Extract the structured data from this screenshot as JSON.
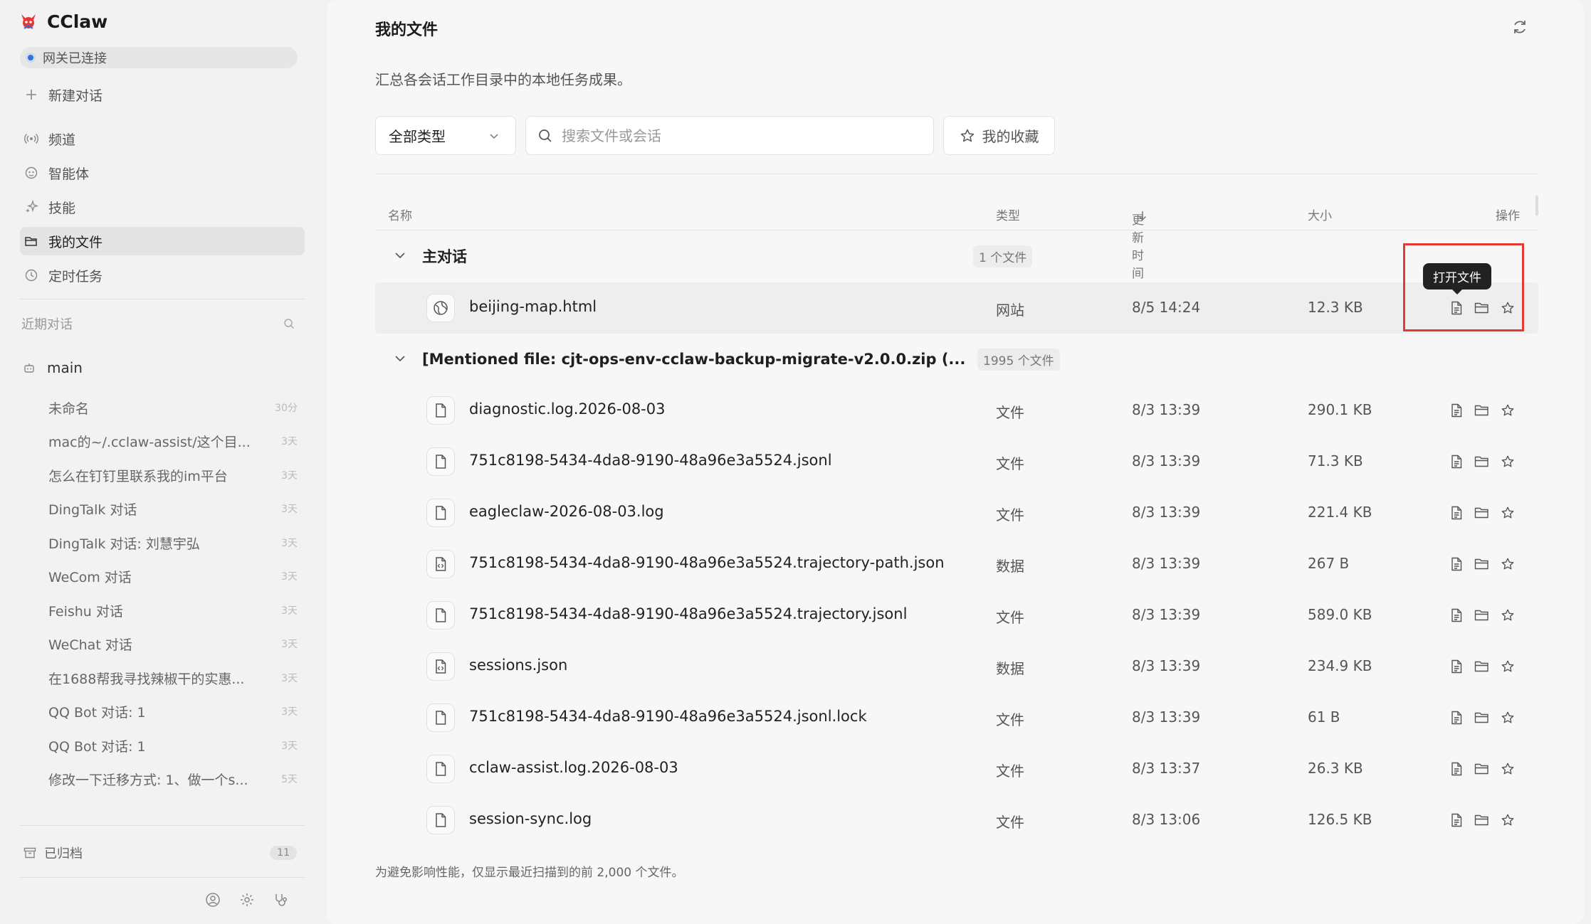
{
  "app": {
    "name": "CClaw",
    "brand_color": "#e53935"
  },
  "gateway": {
    "status": "网关已连接",
    "dot_color": "#2b74d8"
  },
  "nav": {
    "new_chat": "新建对话",
    "channels": "频道",
    "agents": "智能体",
    "skills": "技能",
    "my_files": "我的文件",
    "scheduled": "定时任务"
  },
  "recent": {
    "header": "近期对话",
    "group": "main",
    "items": [
      {
        "title": "未命名",
        "time": "30分"
      },
      {
        "title": "mac的~/.cclaw-assist/这个目...",
        "time": "3天"
      },
      {
        "title": "怎么在钉钉里联系我的im平台",
        "time": "3天"
      },
      {
        "title": "DingTalk 对话",
        "time": "3天"
      },
      {
        "title": "DingTalk 对话: 刘慧宇弘",
        "time": "3天"
      },
      {
        "title": "WeCom 对话",
        "time": "3天"
      },
      {
        "title": "Feishu 对话",
        "time": "3天"
      },
      {
        "title": "WeChat 对话",
        "time": "3天"
      },
      {
        "title": "在1688帮我寻找辣椒干的实惠...",
        "time": "3天"
      },
      {
        "title": "QQ Bot 对话: 1",
        "time": "3天"
      },
      {
        "title": "QQ Bot 对话: 1",
        "time": "3天"
      },
      {
        "title": "修改一下迁移方式: 1、做一个s...",
        "time": "5天"
      }
    ]
  },
  "archived": {
    "label": "已归档",
    "count": "11"
  },
  "page": {
    "title": "我的文件",
    "subtitle": "汇总各会话工作目录中的本地任务成果。",
    "type_filter": "全部类型",
    "search_placeholder": "搜索文件或会话",
    "favorites": "我的收藏",
    "footnote": "为避免影响性能，仅显示最近扫描到的前 2,000 个文件。"
  },
  "table": {
    "headers": {
      "name": "名称",
      "type": "类型",
      "updated": "更新时间",
      "size": "大小",
      "actions": "操作"
    },
    "tooltip": "打开文件",
    "groups": [
      {
        "title": "主对话",
        "count": "1 个文件"
      },
      {
        "title": "[Mentioned file: cjt-ops-env-cclaw-backup-migrate-v2.0.0.zip (...",
        "count": "1995 个文件"
      }
    ],
    "rows": [
      {
        "name": "beijing-map.html",
        "type": "网站",
        "time": "8/5 14:24",
        "size": "12.3 KB",
        "icon": "globe-icon"
      },
      {
        "name": "diagnostic.log.2026-08-03",
        "type": "文件",
        "time": "8/3 13:39",
        "size": "290.1 KB",
        "icon": "file-icon"
      },
      {
        "name": "751c8198-5434-4da8-9190-48a96e3a5524.jsonl",
        "type": "文件",
        "time": "8/3 13:39",
        "size": "71.3 KB",
        "icon": "file-icon"
      },
      {
        "name": "eagleclaw-2026-08-03.log",
        "type": "文件",
        "time": "8/3 13:39",
        "size": "221.4 KB",
        "icon": "file-icon"
      },
      {
        "name": "751c8198-5434-4da8-9190-48a96e3a5524.trajectory-path.json",
        "type": "数据",
        "time": "8/3 13:39",
        "size": "267 B",
        "icon": "code-file-icon"
      },
      {
        "name": "751c8198-5434-4da8-9190-48a96e3a5524.trajectory.jsonl",
        "type": "文件",
        "time": "8/3 13:39",
        "size": "589.0 KB",
        "icon": "file-icon"
      },
      {
        "name": "sessions.json",
        "type": "数据",
        "time": "8/3 13:39",
        "size": "234.9 KB",
        "icon": "code-file-icon"
      },
      {
        "name": "751c8198-5434-4da8-9190-48a96e3a5524.jsonl.lock",
        "type": "文件",
        "time": "8/3 13:39",
        "size": "61 B",
        "icon": "file-icon"
      },
      {
        "name": "cclaw-assist.log.2026-08-03",
        "type": "文件",
        "time": "8/3 13:37",
        "size": "26.3 KB",
        "icon": "file-icon"
      },
      {
        "name": "session-sync.log",
        "type": "文件",
        "time": "8/3 13:06",
        "size": "126.5 KB",
        "icon": "file-icon"
      }
    ]
  }
}
